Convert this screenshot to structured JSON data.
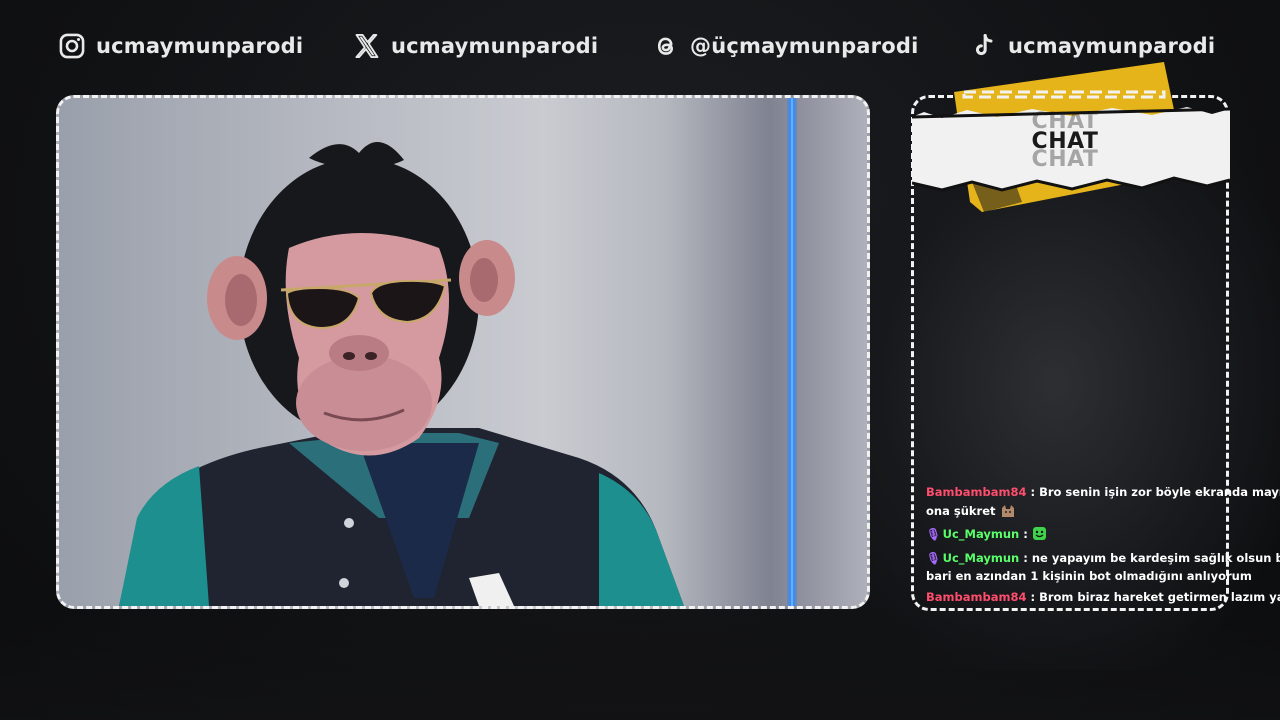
{
  "socials": [
    {
      "platform": "instagram",
      "icon": "instagram-icon",
      "handle": "ucmaymunparodi"
    },
    {
      "platform": "x",
      "icon": "x-logo-icon",
      "handle": "ucmaymunparodi"
    },
    {
      "platform": "threads",
      "icon": "threads-icon",
      "handle": "@üçmaymunparodi"
    },
    {
      "platform": "tiktok",
      "icon": "tiktok-icon",
      "handle": "ucmaymunparodi"
    }
  ],
  "chat": {
    "title_lines": [
      "CHAT",
      "CHAT",
      "CHAT"
    ],
    "messages": [
      {
        "user": "Bambambam84",
        "user_color": "#ff4d6d",
        "has_mic": false,
        "text": "Bro senin işin zor böyle ekranda maymunla fal",
        "text2": "ona şükret",
        "emote": "cat-emote"
      },
      {
        "user": "Uc_Maymun",
        "user_color": "#59ff6a",
        "has_mic": true,
        "text": "",
        "emote": "green-smile-emote"
      },
      {
        "user": "Uc_Maymun",
        "user_color": "#59ff6a",
        "has_mic": true,
        "text": "ne yapayım be kardeşim sağlık olsun bak arada",
        "text2": "bari en azından 1 kişinin bot olmadığını anlıyorum"
      },
      {
        "user": "Bambambam84",
        "user_color": "#ff4d6d",
        "has_mic": false,
        "text": "Brom biraz hareket getirmen lazım yayına"
      }
    ],
    "separator": " : "
  },
  "colors": {
    "accent_yellow": "#e5b41b",
    "frame": "#f2f2f2",
    "neon": "#2f8cff"
  }
}
